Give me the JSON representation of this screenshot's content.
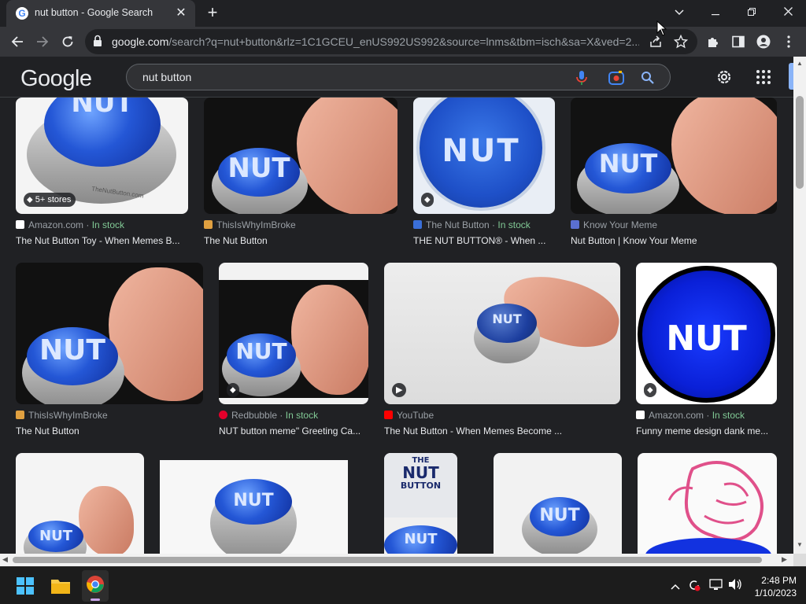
{
  "browser": {
    "tab_title": "nut button - Google Search",
    "new_tab_label": "+",
    "close_tab_label": "✕",
    "url_host": "google.com",
    "url_path": "/search?q=nut+button&rlz=1C1GCEU_enUS992US992&source=lnms&tbm=isch&sa=X&ved=2..."
  },
  "google": {
    "logo_text": "Google",
    "query": "nut button"
  },
  "results": [
    {
      "source": "Amazon.com",
      "stock": "In stock",
      "title": "The Nut Button Toy - When Memes B...",
      "badge": "5+ stores",
      "fav_color": "#ffffff"
    },
    {
      "source": "ThisIsWhyImBroke",
      "stock": "",
      "title": "The Nut Button",
      "badge": "",
      "fav_color": "#e0a040"
    },
    {
      "source": "The Nut Button",
      "stock": "In stock",
      "title": "THE NUT BUTTON® - When ...",
      "badge": "",
      "fav_color": "#3a6fd8"
    },
    {
      "source": "Know Your Meme",
      "stock": "",
      "title": "Nut Button | Know Your Meme",
      "badge": "",
      "fav_color": "#5a6fd0"
    },
    {
      "source": "ThisIsWhyImBroke",
      "stock": "",
      "title": "The Nut Button",
      "badge": "",
      "fav_color": "#e0a040"
    },
    {
      "source": "Redbubble",
      "stock": "In stock",
      "title": "NUT button meme\" Greeting Ca...",
      "badge": "",
      "fav_color": "#e4002b"
    },
    {
      "source": "YouTube",
      "stock": "",
      "title": "The Nut Button - When Memes Become ...",
      "badge": "",
      "fav_color": "#ff0000"
    },
    {
      "source": "Amazon.com",
      "stock": "In stock",
      "title": "Funny meme design dank me...",
      "badge": "",
      "fav_color": "#ffffff"
    }
  ],
  "separator": " · ",
  "thumb_labels": {
    "nut": "NUT",
    "the": "THE",
    "button": "BUTTON",
    "watermark": "TheNutButton.com"
  },
  "taskbar": {
    "time": "2:48 PM",
    "date": "1/10/2023"
  },
  "colors": {
    "page_bg": "#202124",
    "stock_green": "#81c995",
    "button_blue": "#2457d6"
  }
}
